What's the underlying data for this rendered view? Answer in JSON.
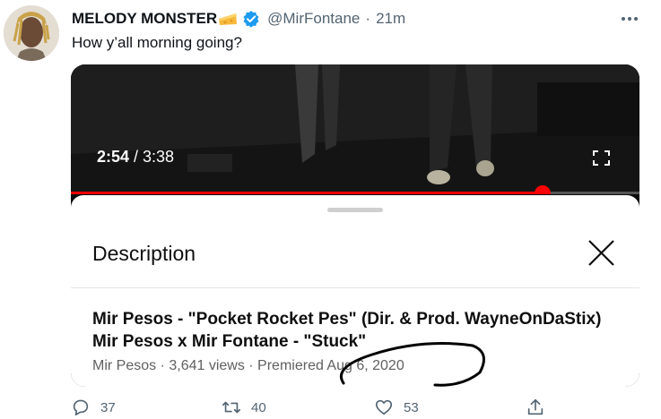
{
  "tweet": {
    "display_name": "MELODY MONSTER",
    "handle": "@MirFontane",
    "separator": "·",
    "time": "21m",
    "text": "How y’all morning going?",
    "media": {
      "current_time": "2:54",
      "total_time": " / 3:38",
      "progress_fraction": 0.83,
      "description_heading": "Description",
      "video_title": "Mir Pesos - \"Pocket Rocket Pes\" (Dir. & Prod. WayneOnDaStix) Mir Pesos x Mir Fontane - \"Stuck\"",
      "meta": "Mir Pesos · 3,641 views · Premiered Aug 6, 2020"
    },
    "actions": {
      "replies": "37",
      "retweets": "40",
      "likes": "53"
    }
  },
  "colors": {
    "accent_blue": "#1d9bf0",
    "progress_red": "#ff0000",
    "secondary_text": "#536471"
  }
}
